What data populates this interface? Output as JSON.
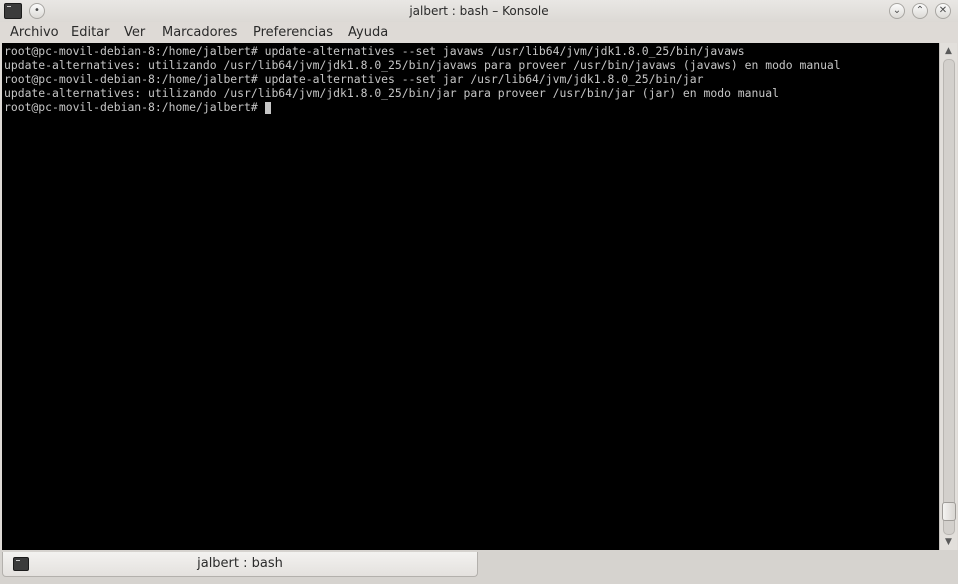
{
  "window": {
    "title": "jalbert : bash – Konsole",
    "icons": {
      "app": "terminal-icon",
      "pin": "pin-icon",
      "minimize": "minimize-icon",
      "maximize": "maximize-icon",
      "close": "close-icon"
    }
  },
  "menubar": {
    "items": [
      "Archivo",
      "Editar",
      "Ver",
      "Marcadores",
      "Preferencias",
      "Ayuda"
    ]
  },
  "terminal": {
    "lines": [
      "root@pc-movil-debian-8:/home/jalbert# update-alternatives --set javaws /usr/lib64/jvm/jdk1.8.0_25/bin/javaws",
      "update-alternatives: utilizando /usr/lib64/jvm/jdk1.8.0_25/bin/javaws para proveer /usr/bin/javaws (javaws) en modo manual",
      "root@pc-movil-debian-8:/home/jalbert# update-alternatives --set jar /usr/lib64/jvm/jdk1.8.0_25/bin/jar",
      "update-alternatives: utilizando /usr/lib64/jvm/jdk1.8.0_25/bin/jar para proveer /usr/bin/jar (jar) en modo manual",
      "root@pc-movil-debian-8:/home/jalbert# "
    ],
    "colors": {
      "background": "#000000",
      "foreground": "#c6c6c6"
    }
  },
  "tabs": [
    {
      "label": "jalbert : bash",
      "icon": "terminal-icon"
    }
  ]
}
